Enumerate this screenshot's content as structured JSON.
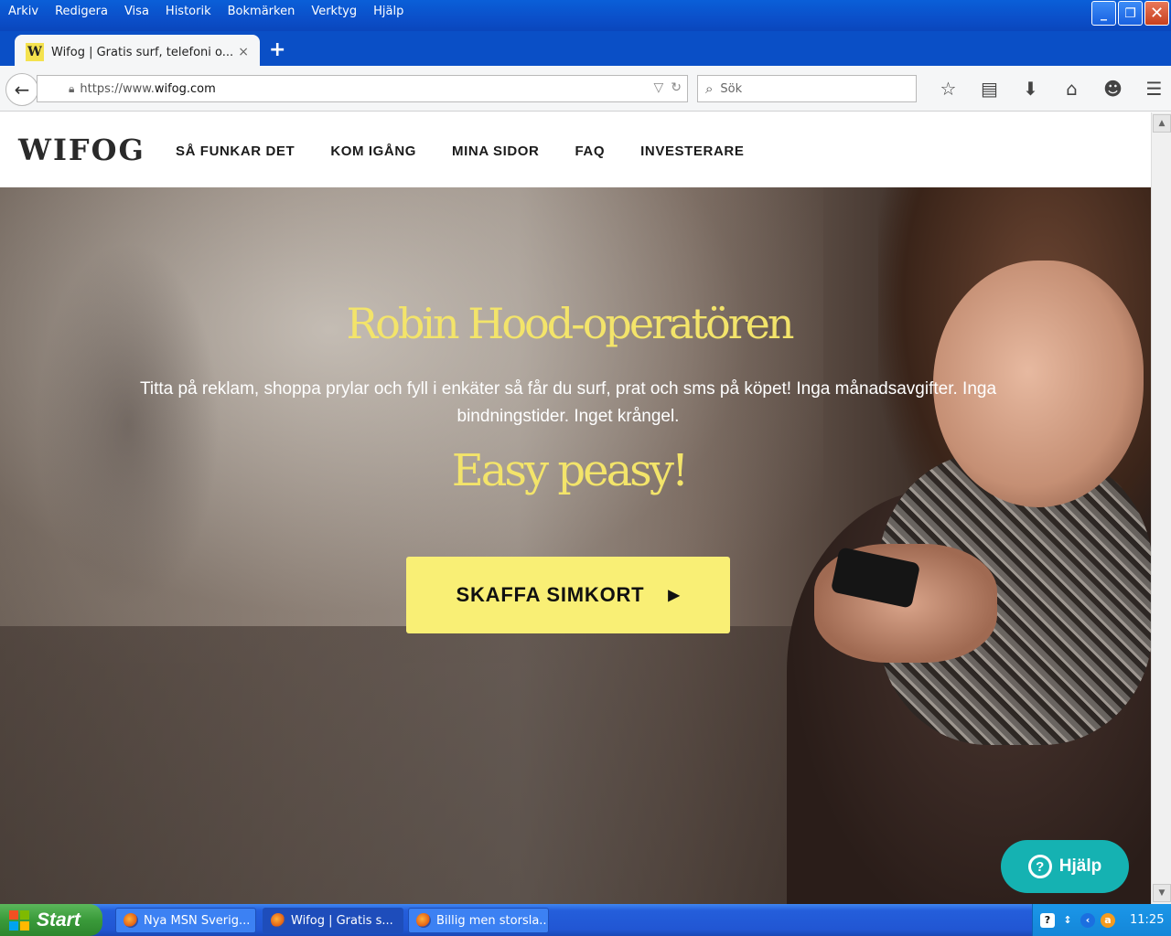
{
  "menu": [
    "Arkiv",
    "Redigera",
    "Visa",
    "Historik",
    "Bokmärken",
    "Verktyg",
    "Hjälp"
  ],
  "window_controls": {
    "minimize": "_",
    "restore": "❐",
    "close": "✕"
  },
  "tab": {
    "favicon_letter": "W",
    "title": "Wifog | Gratis surf, telefoni o...",
    "close": "×"
  },
  "new_tab": "+",
  "nav": {
    "back_icon": "arrow-left-icon",
    "url_prefix": "https://www.",
    "url_host": "wifog.com",
    "search_placeholder": "Sök"
  },
  "toolbar_icons": [
    "star-icon",
    "reading-list-icon",
    "download-icon",
    "home-icon",
    "chat-icon",
    "menu-icon"
  ],
  "site": {
    "logo": "WIFOG",
    "nav_items": [
      "SÅ FUNKAR DET",
      "KOM IGÅNG",
      "MINA SIDOR",
      "FAQ",
      "INVESTERARE"
    ],
    "hero_title": "Robin Hood-operatören",
    "hero_text": "Titta på reklam, shoppa prylar och fyll i enkäter så får du surf, prat och sms på köpet! Inga månadsavgifter. Inga bindningstider. Inget krångel.",
    "hero_sub": "Easy peasy!",
    "cta_label": "SKAFFA SIMKORT",
    "cta_arrow": "▶",
    "help_label": "Hjälp",
    "help_icon": "?"
  },
  "taskbar": {
    "start_label": "Start",
    "tasks": [
      "Nya MSN Sverig...",
      "Wifog | Gratis s...",
      "Billig men storsla..."
    ],
    "clock": "11:25"
  },
  "colors": {
    "accent_yellow": "#f3e46a",
    "cta_yellow": "#f9ef75",
    "help_teal": "#15b2b2",
    "xp_blue": "#0a4fc6"
  }
}
